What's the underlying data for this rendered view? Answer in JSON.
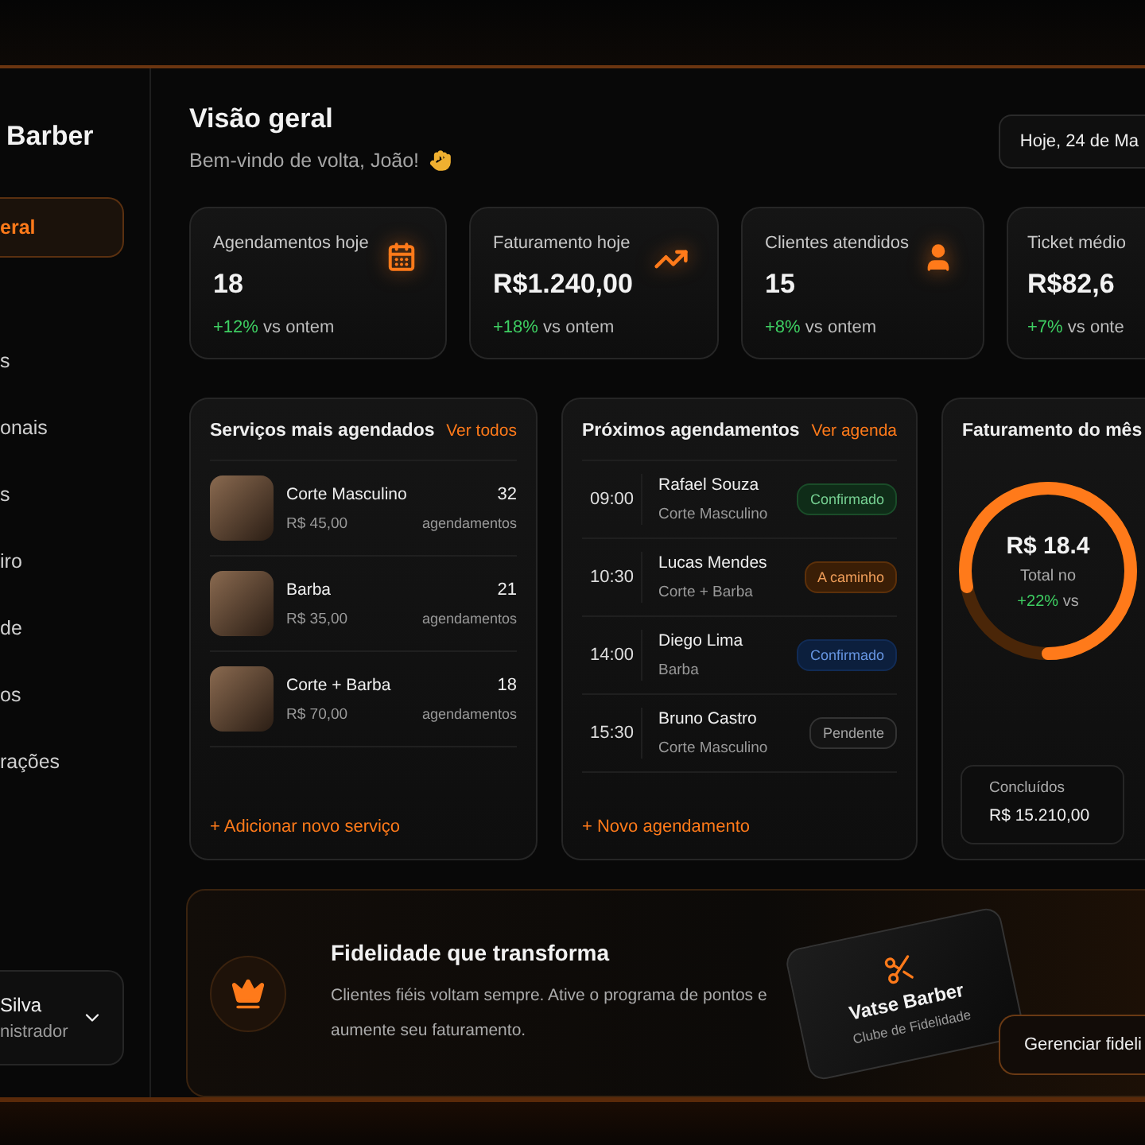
{
  "sidebar": {
    "brand": "Barber",
    "items": [
      {
        "label": "eral",
        "selected": true
      },
      {
        "label": "s",
        "selected": false
      },
      {
        "label": "onais",
        "selected": false
      },
      {
        "label": "s",
        "selected": false
      },
      {
        "label": "iro",
        "selected": false
      },
      {
        "label": "de",
        "selected": false
      },
      {
        "label": "os",
        "selected": false
      },
      {
        "label": "rações",
        "selected": false
      }
    ],
    "user": {
      "name": "Silva",
      "role": "nistrador"
    }
  },
  "header": {
    "title": "Visão geral",
    "subtitle": "Bem-vindo de volta, João!",
    "date": "Hoje, 24 de Ma"
  },
  "stats": [
    {
      "label": "Agendamentos hoje",
      "value": "18",
      "change": "+12%",
      "note": "vs ontem"
    },
    {
      "label": "Faturamento hoje",
      "value": "R$1.240,00",
      "change": "+18%",
      "note": "vs ontem"
    },
    {
      "label": "Clientes atendidos",
      "value": "15",
      "change": "+8%",
      "note": "vs ontem"
    },
    {
      "label": "Ticket médio",
      "value": "R$82,6",
      "change": "+7%",
      "note": "vs onte"
    }
  ],
  "services": {
    "title": "Serviços mais agendados",
    "link": "Ver todos",
    "items": [
      {
        "name": "Corte Masculino",
        "price": "R$ 45,00",
        "count": "32",
        "unit": "agendamentos"
      },
      {
        "name": "Barba",
        "price": "R$ 35,00",
        "count": "21",
        "unit": "agendamentos"
      },
      {
        "name": "Corte + Barba",
        "price": "R$ 70,00",
        "count": "18",
        "unit": "agendamentos"
      }
    ],
    "add": "+ Adicionar novo serviço"
  },
  "appointments": {
    "title": "Próximos agendamentos",
    "link": "Ver agenda",
    "items": [
      {
        "time": "09:00",
        "name": "Rafael Souza",
        "service": "Corte Masculino",
        "status": "Confirmado",
        "color": "#0f2c18"
      },
      {
        "time": "10:30",
        "name": "Lucas Mendes",
        "service": "Corte + Barba",
        "status": "A caminho",
        "color": "#3a1e06"
      },
      {
        "time": "14:00",
        "name": "Diego Lima",
        "service": "Barba",
        "status": "Confirmado",
        "color": "#0c1f3d"
      },
      {
        "time": "15:30",
        "name": "Bruno Castro",
        "service": "Corte Masculino",
        "status": "Pendente",
        "color": "#141414"
      }
    ],
    "add": "+ Novo agendamento"
  },
  "revenue": {
    "title": "Faturamento do mês",
    "total": "R$ 18.4",
    "caption": "Total no",
    "change": "+22%",
    "note": "vs",
    "level": 0.78,
    "completed_label": "Concluídos",
    "completed_value": "R$ 15.210,00"
  },
  "loyalty": {
    "title": "Fidelidade que transforma",
    "text": "Clientes fiéis voltam sempre. Ative o programa de pontos e aumente seu faturamento.",
    "card_title": "Vatse Barber",
    "card_subtitle": "Clube de Fidelidade",
    "button": "Gerenciar fideli"
  }
}
